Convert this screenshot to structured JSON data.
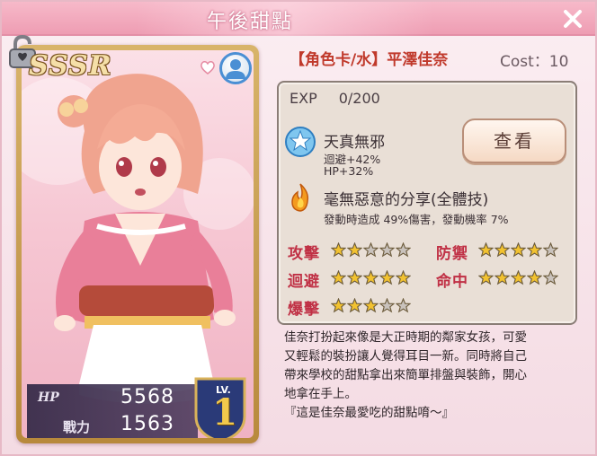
{
  "window": {
    "title": "午後甜點"
  },
  "card": {
    "rarity": "SSSR",
    "hp_label": "HP",
    "hp_value": "5568",
    "power_label": "戰力",
    "power_value": "1563",
    "lv_label": "LV.",
    "lv_value": "1"
  },
  "character": {
    "name_line": "【角色卡/水】平澤佳奈",
    "cost": "Cost：10"
  },
  "exp": {
    "label": "EXP",
    "value": "0/200"
  },
  "skills": [
    {
      "name": "天真無邪",
      "desc_1": "迴避+42%",
      "desc_2": "HP+32%",
      "icon": "blue-star-icon"
    },
    {
      "name": "毫無惡意的分享(全體技)",
      "desc_1": "發動時造成 49%傷害，發動機率 7%",
      "icon": "flame-icon"
    }
  ],
  "view_button": "查看",
  "attributes": [
    {
      "label": "攻擊",
      "stars": 2,
      "max": 5
    },
    {
      "label": "防禦",
      "stars": 4,
      "max": 5
    },
    {
      "label": "迴避",
      "stars": 5,
      "max": 5
    },
    {
      "label": "命中",
      "stars": 4,
      "max": 5
    },
    {
      "label": "爆擊",
      "stars": 3,
      "max": 5
    }
  ],
  "description": [
    "佳奈打扮起來像是大正時期的鄰家女孩，可愛",
    "又輕鬆的裝扮讓人覺得耳目一新。同時將自己",
    "帶來學校的甜點拿出來簡單排盤與裝飾，開心",
    "地拿在手上。",
    "『這是佳奈最愛吃的甜點唷～』"
  ],
  "colors": {
    "title_bar": "#ee9db3",
    "attr_label": "#c03045",
    "name_line": "#c0392b",
    "star_filled": "#f2c230",
    "star_empty": "#c9c2bc"
  }
}
